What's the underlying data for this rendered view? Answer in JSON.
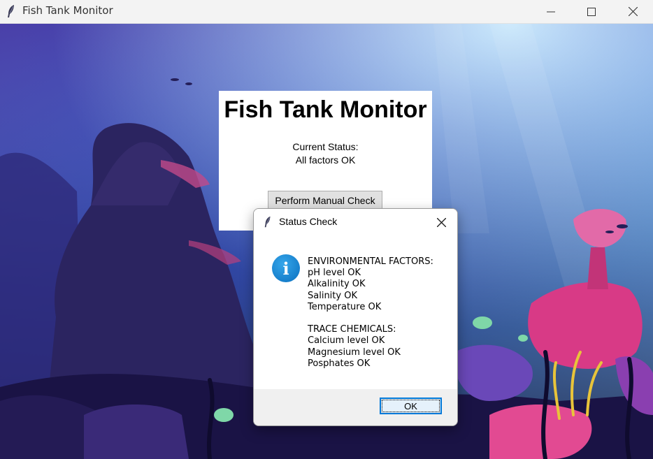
{
  "window": {
    "title": "Fish Tank Monitor",
    "icon": "feather-icon",
    "controls": [
      "minimize-icon",
      "maximize-icon",
      "close-icon"
    ]
  },
  "panel": {
    "title": "Fish Tank Monitor",
    "status_label": "Current Status:",
    "status_value": "All factors OK",
    "manual_check_label": "Perform Manual Check"
  },
  "dialog": {
    "title": "Status Check",
    "icon": "info-icon",
    "message": "ENVIRONMENTAL FACTORS:\npH level OK\nAlkalinity OK\nSalinity OK\nTemperature OK\n\nTRACE CHEMICALS:\nCalcium level OK\nMagnesium level OK\nPosphates OK",
    "ok_label": "OK"
  },
  "colors": {
    "accent": "#0078d7",
    "info_blue": "#1a8ad8",
    "water_deep": "#1d1a5c",
    "water_light": "#8fd0f5"
  }
}
